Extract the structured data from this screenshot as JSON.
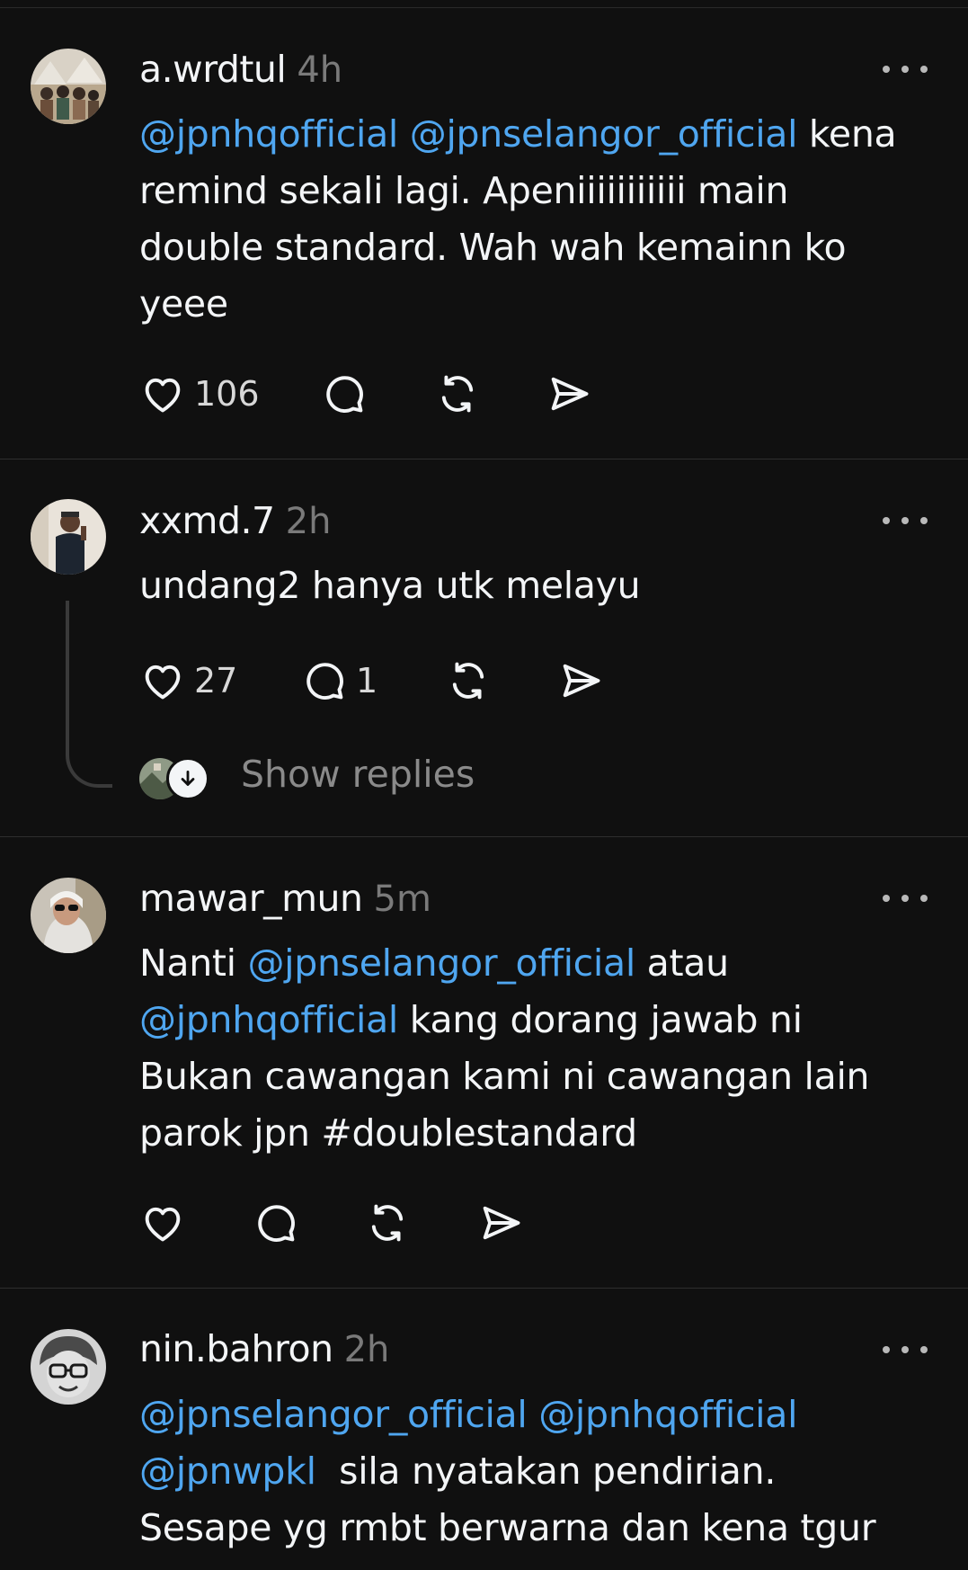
{
  "posts": [
    {
      "username": "a.wrdtul",
      "time": "4h",
      "lines": [
        [
          {
            "t": "@jpnhqofficial",
            "m": true
          },
          {
            "t": " "
          },
          {
            "t": "@jpnselangor_official",
            "m": true
          },
          {
            "t": " kena"
          }
        ],
        [
          {
            "t": "remind sekali lagi. Apeniiiiiiiiiii main"
          }
        ],
        [
          {
            "t": "double standard. Wah wah kemainn ko"
          }
        ],
        [
          {
            "t": "yeee"
          }
        ]
      ],
      "likes": "106",
      "replies": ""
    },
    {
      "username": "xxmd.7",
      "time": "2h",
      "lines": [
        [
          {
            "t": "undang2 hanya utk melayu"
          }
        ]
      ],
      "likes": "27",
      "replies": "1",
      "show_replies": "Show replies"
    },
    {
      "username": "mawar_mun",
      "time": "5m",
      "lines": [
        [
          {
            "t": "Nanti "
          },
          {
            "t": "@jpnselangor_official",
            "m": true
          },
          {
            "t": " atau"
          }
        ],
        [
          {
            "t": "@jpnhqofficial",
            "m": true
          },
          {
            "t": " kang dorang jawab ni"
          }
        ],
        [
          {
            "t": "Bukan cawangan kami ni cawangan lain"
          }
        ],
        [
          {
            "t": "parok jpn #doublestandard"
          }
        ]
      ],
      "likes": "",
      "replies": ""
    },
    {
      "username": "nin.bahron",
      "time": "2h",
      "lines": [
        [
          {
            "t": "@jpnselangor_official",
            "m": true
          },
          {
            "t": " "
          },
          {
            "t": "@jpnhqofficial",
            "m": true
          }
        ],
        [
          {
            "t": "@jpnwpkl",
            "m": true
          },
          {
            "t": "  sila nyatakan pendirian."
          }
        ],
        [
          {
            "t": "Sesape yg rmbt berwarna dan kena tgur"
          }
        ]
      ]
    }
  ],
  "icons": {
    "like": "heart-icon",
    "reply": "comment-bubble-icon",
    "repost": "repost-icon",
    "share": "share-send-icon",
    "more": "more-dots-icon"
  },
  "colors": {
    "background": "#101010",
    "mention": "#4fa6f0",
    "secondary_text": "#7a7a7a"
  }
}
